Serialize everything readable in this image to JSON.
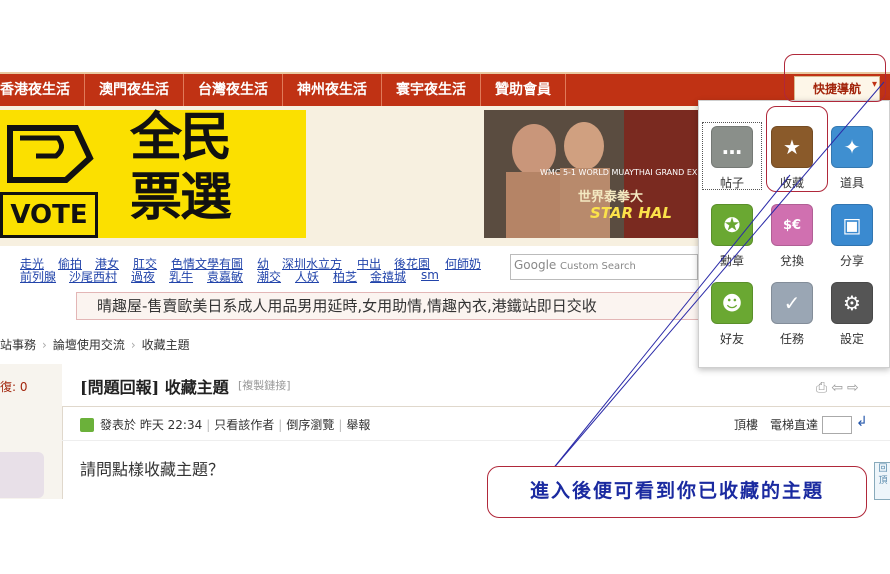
{
  "nav": {
    "items": [
      "香港夜生活",
      "澳門夜生活",
      "台灣夜生活",
      "神州夜生活",
      "寰宇夜生活",
      "贊助會員"
    ],
    "quick_nav": "快捷導航"
  },
  "banners": {
    "vote_title": "全民\n票選",
    "vote_box": "VOTE",
    "fight_sub": "WMC 5-1 WORLD MUAYTHAI GRAND EX",
    "fight_title": "世界泰拳大",
    "fight_bottom": "STAR HAL"
  },
  "links_row1": [
    "走光",
    "偷拍",
    "港女",
    "肛交",
    "色情文學有圖",
    "幼",
    "深圳水立方",
    "中出",
    "後花園",
    "何師奶"
  ],
  "links_row2": [
    "前列腺",
    "沙尾西村",
    "過夜",
    "乳牛",
    "袁嘉敏",
    "潮交",
    "人妖",
    "柏芝",
    "金禧城",
    "sm"
  ],
  "search": {
    "google": "Google",
    "custom": "Custom Search"
  },
  "ad_strip": "晴趣屋-售賣歐美日系成人用品男用延時,女用助情,情趣內衣,港鐵站即日交收",
  "breadcrumb": [
    "站事務",
    "論壇使用交流",
    "收藏主題"
  ],
  "thread": {
    "reply_label": "復: 0",
    "title": "[問題回報] 收藏主題",
    "copy_link": "[複製鏈接]",
    "meta": [
      "發表於 昨天 22:34",
      "只看該作者",
      "倒序瀏覽",
      "舉報"
    ],
    "floor": "頂樓",
    "jump": "電梯直達",
    "body": "請問點樣收藏主題？",
    "top_btn": "回頂"
  },
  "popup": {
    "tiles": [
      {
        "label": "帖子",
        "icon": "speech-bubble-icon",
        "color": "#8a8f8a"
      },
      {
        "label": "收藏",
        "icon": "star-icon",
        "color": "#8a5a2a"
      },
      {
        "label": "道具",
        "icon": "magic-wand-icon",
        "color": "#3f8fd0"
      },
      {
        "label": "勳章",
        "icon": "medal-icon",
        "color": "#6aa832"
      },
      {
        "label": "兌換",
        "icon": "currency-exchange-icon",
        "color": "#d070b0"
      },
      {
        "label": "分享",
        "icon": "share-icon",
        "color": "#3a8ad0"
      },
      {
        "label": "好友",
        "icon": "friends-icon",
        "color": "#6aa832"
      },
      {
        "label": "任務",
        "icon": "task-icon",
        "color": "#9aa6b4"
      },
      {
        "label": "設定",
        "icon": "settings-gear-icon",
        "color": "#555555"
      }
    ]
  },
  "annotation": "進入後便可看到你已收藏的主題",
  "colors": {
    "nav_red": "#c03214",
    "annotation_ring": "#b0283a",
    "annotation_text": "#1a2aa0"
  }
}
